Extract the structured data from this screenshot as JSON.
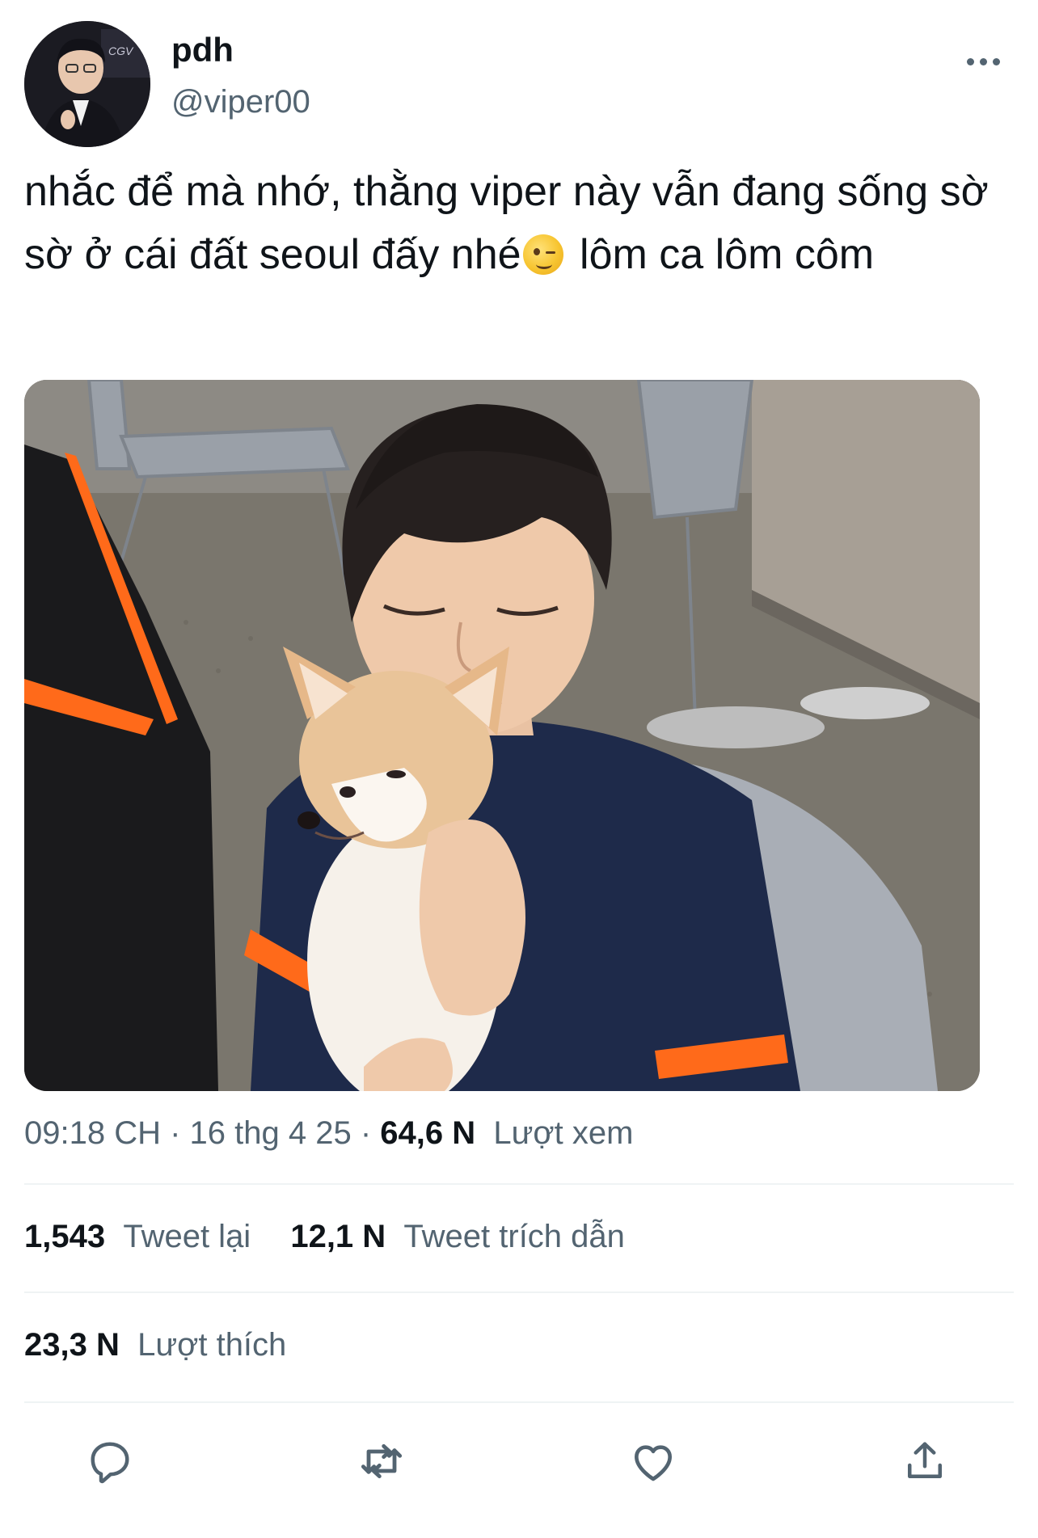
{
  "tweet": {
    "display_name": "pdh",
    "handle": "@viper00",
    "text_before_emoji": "nhắc để mà nhớ, thằng viper này vẫn đang sống sờ sờ ở cái đất seoul đấy nhé",
    "text_after_emoji": " lôm ca lôm côm",
    "emoji": "winking-face",
    "time": "09:18 CH",
    "date": "16 thg 4 25",
    "views_count": "64,6 N",
    "views_label": "Lượt xem",
    "retweets_count": "1,543",
    "retweets_label": "Tweet lại",
    "quotes_count": "12,1 N",
    "quotes_label": "Tweet trích dẫn",
    "likes_count": "23,3 N",
    "likes_label": "Lượt thích"
  },
  "icons": {
    "more": "more-horizontal-icon",
    "reply": "reply-icon",
    "retweet": "retweet-icon",
    "like": "heart-icon",
    "share": "share-icon"
  },
  "colors": {
    "text_primary": "#0f1419",
    "text_secondary": "#536471",
    "divider": "#eff3f4",
    "jersey_navy": "#1e2a4a",
    "jersey_orange": "#ff6a1a"
  }
}
